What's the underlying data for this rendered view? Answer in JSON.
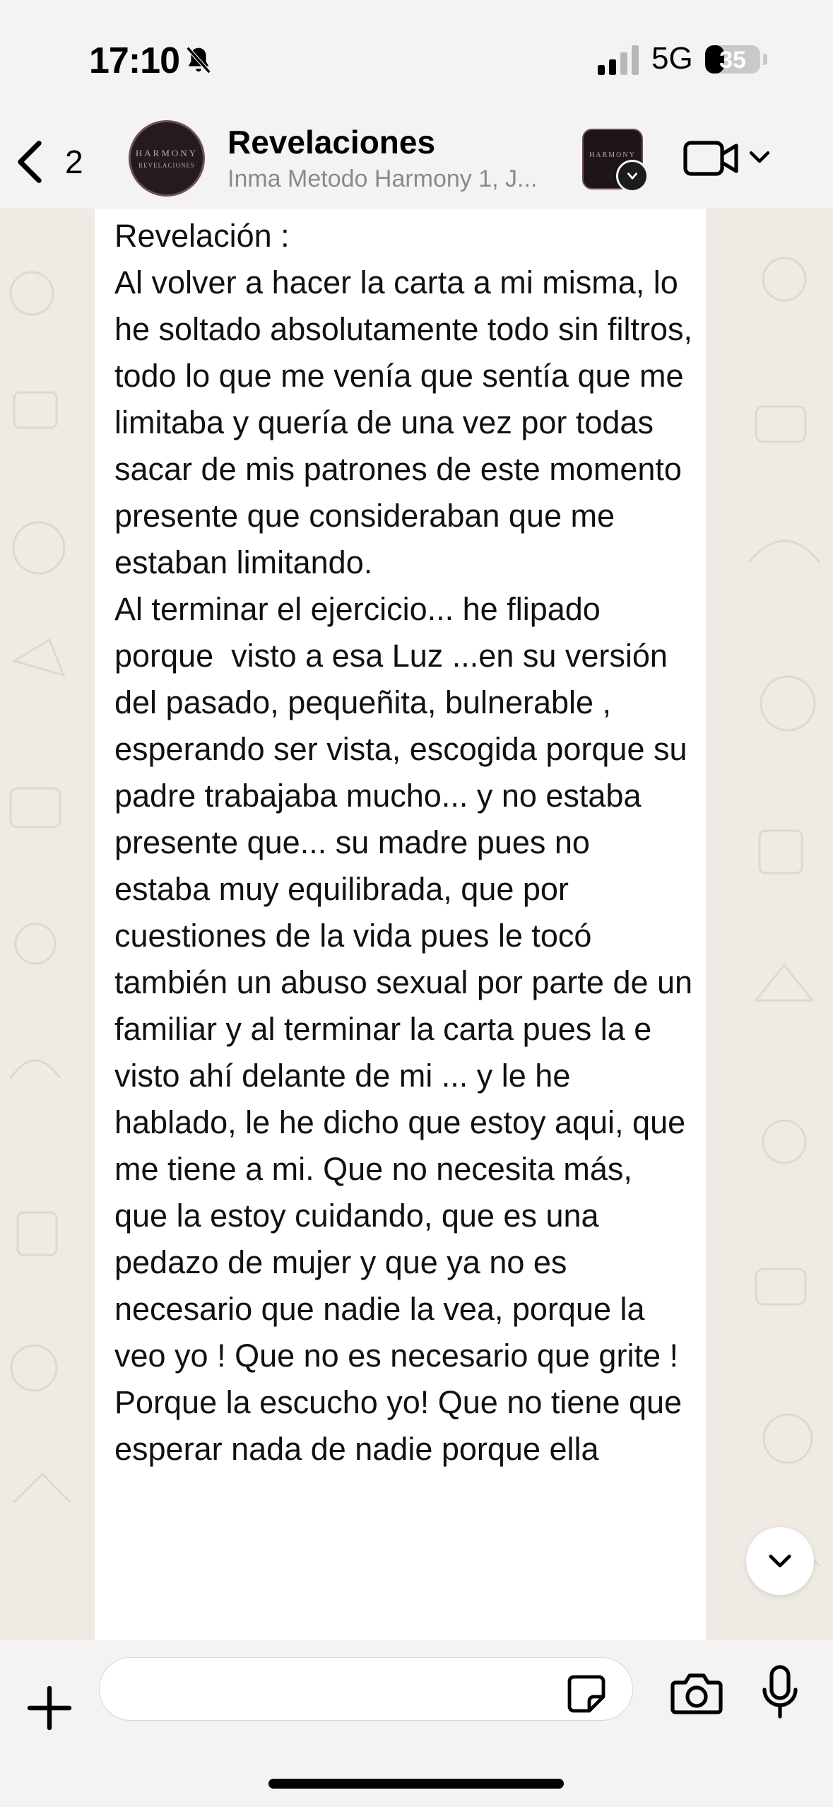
{
  "status_bar": {
    "time": "17:10",
    "network": "5G",
    "battery_percent": "35",
    "battery_level": 0.35,
    "icons": [
      "bell-slash-icon",
      "signal-icon"
    ]
  },
  "header": {
    "back_count": "2",
    "title": "Revelaciones",
    "subtitle": "Inma Metodo Harmony 1, J...",
    "avatar_text": "HARMONY",
    "avatar_subtext": "REVELACIONES",
    "thumb_text": "HARMONY"
  },
  "message": {
    "text": "Revelación :\nAl volver a hacer la carta a mi misma, lo he soltado absolutamente todo sin filtros, todo lo que me venía que sentía que me limitaba y quería de una vez por todas sacar de mis patrones de este momento presente que consideraban que me estaban limitando.\nAl terminar el ejercicio... he flipado porque  visto a esa Luz ...en su versión del pasado, pequeñita, bulnerable , esperando ser vista, escogida porque su padre trabajaba mucho... y no estaba presente que... su madre pues no estaba muy equilibrada, que por cuestiones de la vida pues le tocó también un abuso sexual por parte de un familiar y al terminar la carta pues la e visto ahí delante de mi ... y le he hablado, le he dicho que estoy aqui, que me tiene a mi. Que no necesita más, que la estoy cuidando, que es una pedazo de mujer y que ya no es necesario que nadie la vea, porque la veo yo ! Que no es necesario que grite ! Porque la escucho yo! Que no tiene que esperar nada de nadie porque ella"
  },
  "composer": {
    "value": "",
    "placeholder": ""
  },
  "colors": {
    "background": "#efebe4",
    "bubble": "#ffffff",
    "bar": "#f4f3f1",
    "secondary_text": "#8a8a8e"
  }
}
